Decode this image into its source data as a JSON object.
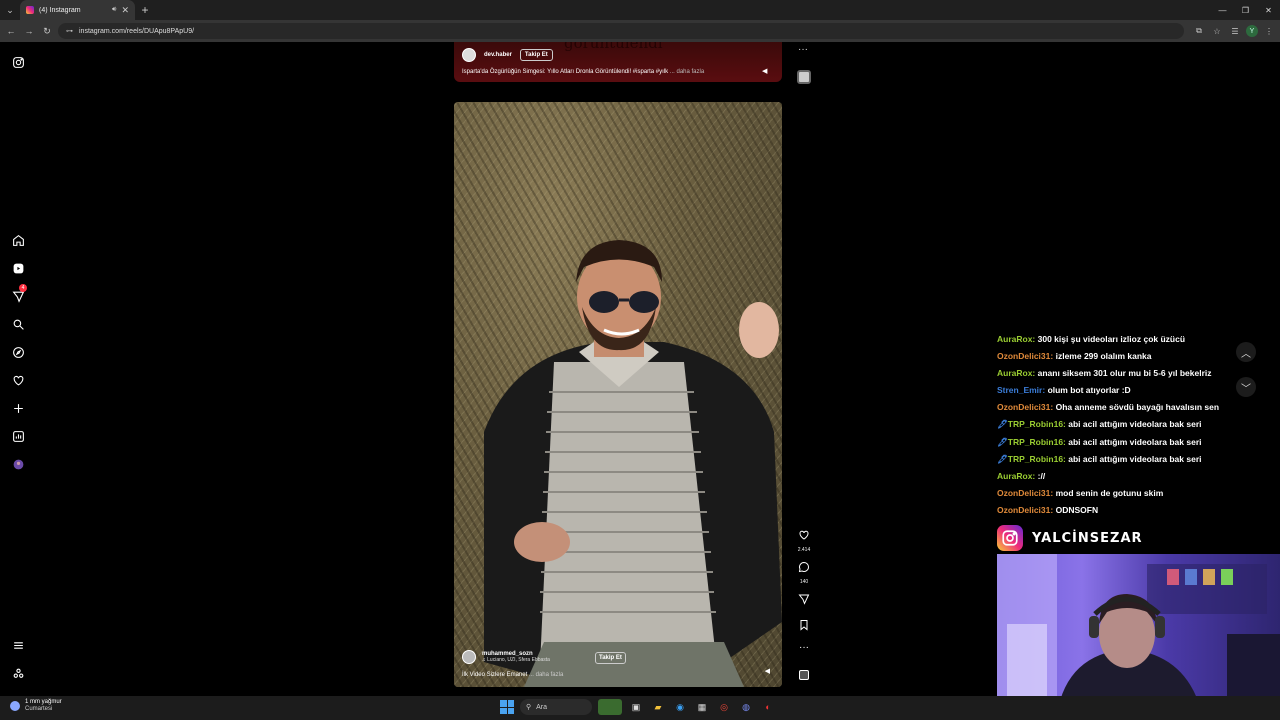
{
  "browser": {
    "tab_title": "(4) Instagram",
    "url": "instagram.com/reels/DUApu8PApU9/",
    "profile_initial": "Y"
  },
  "nav": {
    "notification_count": "4"
  },
  "top_reel": {
    "username": "dev.haber",
    "follow_label": "Takip Et",
    "caption": "Isparta'da Özgürlüğün Simgesi: Yıllo Atları Dronla Görüntülendi! #isparta #yılk",
    "more": "... daha fazla",
    "overlay_title": "görüntülendi"
  },
  "reel": {
    "username": "muhammed_sozn",
    "music": "Luciano, UZI, Sfera Ebbasta",
    "follow_label": "Takip Et",
    "caption": "İlk Video Sizlere Emanet",
    "more": "... daha fazla",
    "likes": "2.414",
    "comments": "140"
  },
  "chat": [
    {
      "user": "AuraRox:",
      "text": "300 kişi şu videoları izlioz çok üzücü",
      "color": "green",
      "badge": ""
    },
    {
      "user": "OzonDelici31:",
      "text": "izleme 299 olalım kanka",
      "color": "orange",
      "badge": ""
    },
    {
      "user": "AuraRox:",
      "text": "ananı siksem 301 olur mu bi 5-6 yıl bekelriz",
      "color": "green",
      "badge": ""
    },
    {
      "user": "Stren_Emir:",
      "text": "olum bot atıyorlar :D",
      "color": "blue",
      "badge": ""
    },
    {
      "user": "OzonDelici31:",
      "text": "Oha anneme sövdü bayağı havalısın sen",
      "color": "orange",
      "badge": ""
    },
    {
      "user": "TRP_Robin16:",
      "text": "abi acil attığım videolara bak seri",
      "color": "green",
      "badge": "🖋"
    },
    {
      "user": "TRP_Robin16:",
      "text": "abi acil attığım videolara bak seri",
      "color": "green",
      "badge": "🖋"
    },
    {
      "user": "TRP_Robin16:",
      "text": "abi acil attığım videolara bak seri",
      "color": "green",
      "badge": "🖋"
    },
    {
      "user": "AuraRox:",
      "text": "://",
      "color": "green",
      "badge": ""
    },
    {
      "user": "OzonDelici31:",
      "text": "mod senin de gotunu skim",
      "color": "orange",
      "badge": ""
    },
    {
      "user": "OzonDelici31:",
      "text": "ODNSOFN",
      "color": "orange",
      "badge": ""
    }
  ],
  "streamer": {
    "instagram_name": "YALCİNSEZAR"
  },
  "taskbar": {
    "weather_line1": "1 mm yağmur",
    "weather_line2": "Cumartesi",
    "search_placeholder": "Ara"
  },
  "colors": {
    "accent_green": "#9acd32",
    "accent_orange": "#e08a3a",
    "accent_blue": "#3b7dd8",
    "notification_red": "#ff3040"
  }
}
